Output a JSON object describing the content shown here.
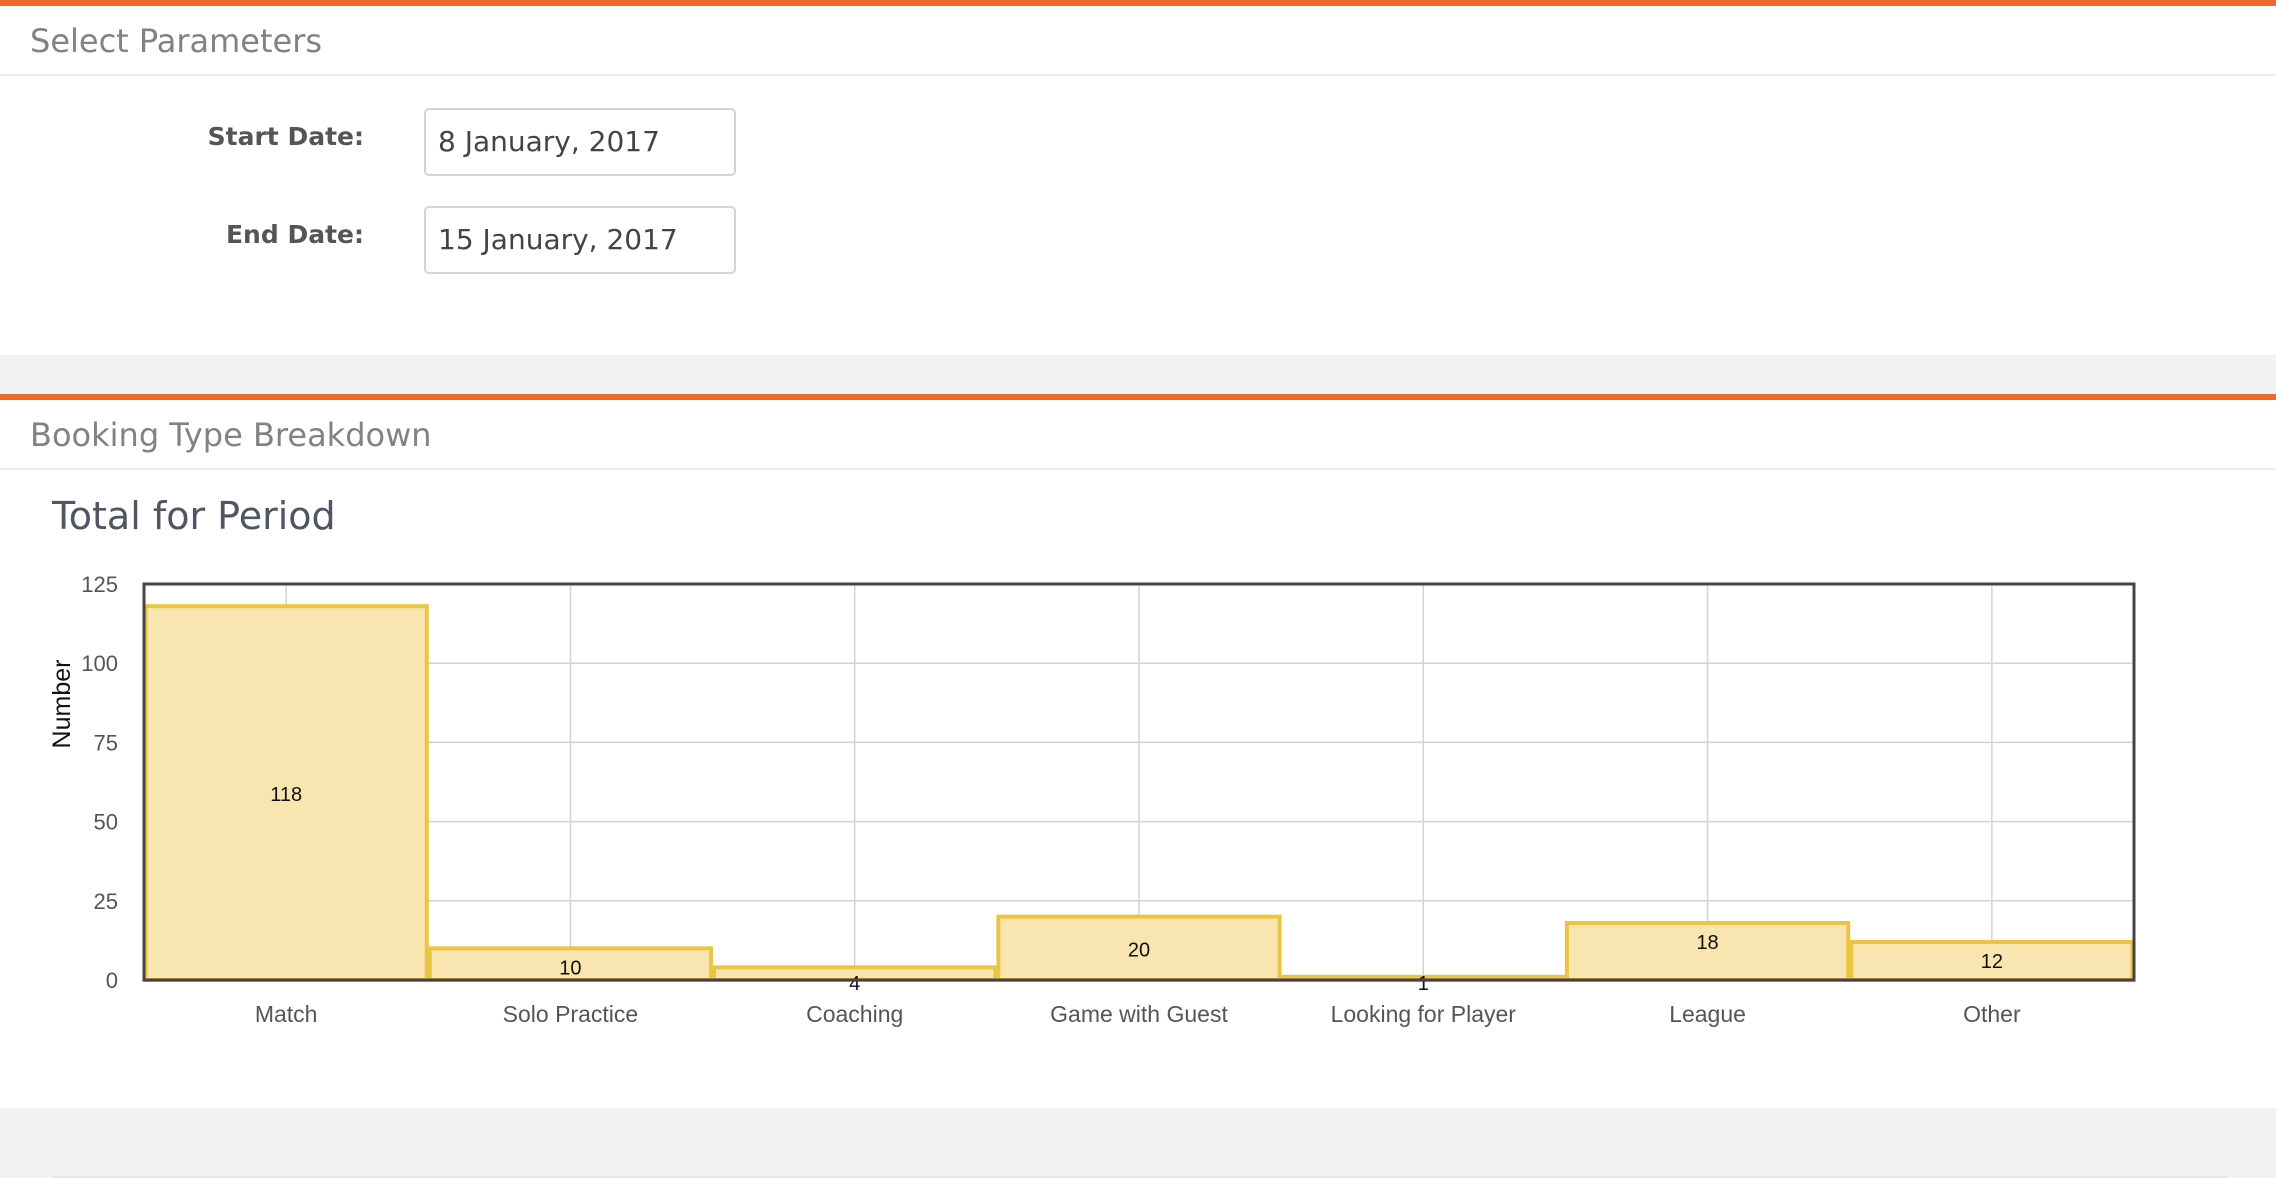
{
  "params_panel": {
    "title": "Select Parameters",
    "start_label": "Start Date:",
    "start_value": "8 January, 2017",
    "end_label": "End Date:",
    "end_value": "15 January, 2017"
  },
  "booking_panel": {
    "title": "Booking Type Breakdown",
    "chart_title": "Total for Period"
  },
  "colors": {
    "accent": "#ee6a2a",
    "bar_fill": "#f8e5b0",
    "bar_stroke": "#ebc540"
  },
  "chart_data": {
    "type": "bar",
    "title": "Total for Period",
    "xlabel": "",
    "ylabel": "Number",
    "categories": [
      "Match",
      "Solo Practice",
      "Coaching",
      "Game with Guest",
      "Looking for Player",
      "League",
      "Other"
    ],
    "values": [
      118,
      10,
      4,
      20,
      1,
      18,
      12
    ],
    "ylim": [
      0,
      125
    ],
    "yticks": [
      0,
      25,
      50,
      75,
      100,
      125
    ],
    "grid": true,
    "legend": "none"
  }
}
